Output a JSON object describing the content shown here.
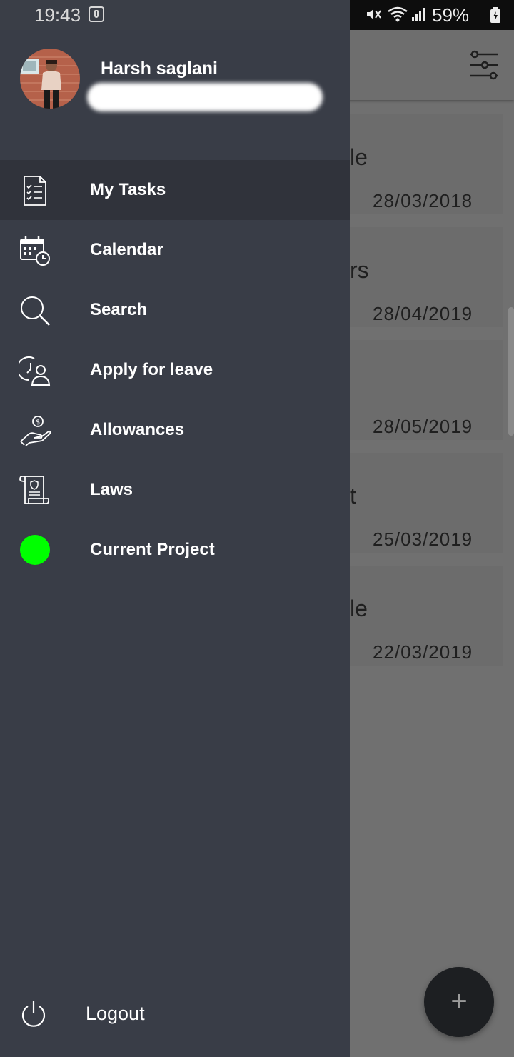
{
  "status_bar": {
    "time": "19:43",
    "battery": "59%"
  },
  "drawer": {
    "user": {
      "name": "Harsh saglani"
    },
    "menu": [
      {
        "label": "My Tasks",
        "icon": "tasks-icon",
        "active": true
      },
      {
        "label": "Calendar",
        "icon": "calendar-icon",
        "active": false
      },
      {
        "label": "Search",
        "icon": "search-icon",
        "active": false
      },
      {
        "label": "Apply for leave",
        "icon": "leave-icon",
        "active": false
      },
      {
        "label": "Allowances",
        "icon": "allowance-icon",
        "active": false
      },
      {
        "label": "Laws",
        "icon": "laws-icon",
        "active": false
      },
      {
        "label": "Current Project",
        "icon": "status-dot",
        "active": false,
        "status_color": "#00ff00"
      }
    ],
    "logout_label": "Logout"
  },
  "background_list": {
    "items": [
      {
        "title_fragment": "le",
        "date": "28/03/2018"
      },
      {
        "title_fragment": "rs",
        "date": "28/04/2019"
      },
      {
        "title_fragment": "",
        "date": "28/05/2019"
      },
      {
        "title_fragment": "t",
        "date": "25/03/2019"
      },
      {
        "title_fragment": "le",
        "date": "22/03/2019"
      }
    ]
  },
  "fab_label": "+",
  "colors": {
    "drawer_bg": "#393d47",
    "active_item_bg": "#30333b",
    "status_green": "#00ff00"
  }
}
